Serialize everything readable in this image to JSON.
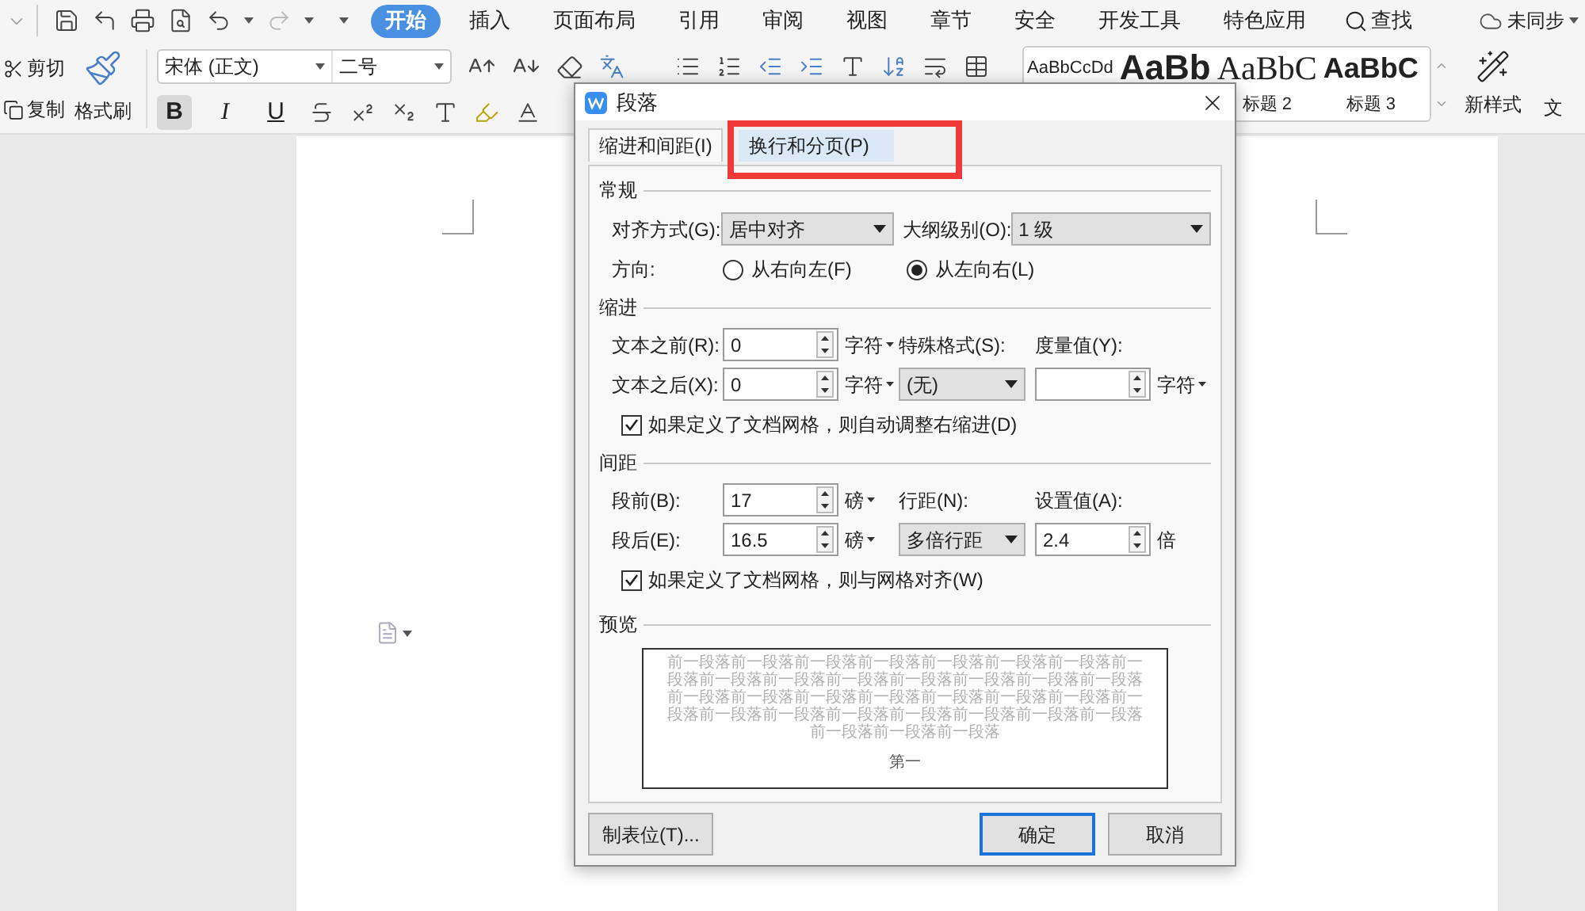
{
  "menu_tabs": [
    {
      "label": "开始",
      "selected": true
    },
    {
      "label": "插入",
      "selected": false
    },
    {
      "label": "页面布局",
      "selected": false
    },
    {
      "label": "引用",
      "selected": false
    },
    {
      "label": "审阅",
      "selected": false
    },
    {
      "label": "视图",
      "selected": false
    },
    {
      "label": "章节",
      "selected": false
    },
    {
      "label": "安全",
      "selected": false
    },
    {
      "label": "开发工具",
      "selected": false
    },
    {
      "label": "特色应用",
      "selected": false
    }
  ],
  "search": "查找",
  "sync_status": "未同步",
  "clipboard": {
    "cut": "剪切",
    "copy": "复制",
    "format_painter": "格式刷"
  },
  "font": {
    "name": "宋体 (正文)",
    "size": "二号"
  },
  "format_buttons": [
    {
      "label": "B",
      "selected": true
    },
    {
      "label": "I",
      "selected": false
    },
    {
      "label": "U",
      "selected": false
    }
  ],
  "styles": [
    {
      "kind": "normal",
      "sample": "AaBbCcDd"
    },
    {
      "kind": "heading1",
      "sample": "AaBb"
    },
    {
      "kind": "heading2",
      "sample": "AaBbC",
      "label": "标题 2"
    },
    {
      "kind": "heading3",
      "sample": "AaBbC",
      "label": "标题 3"
    }
  ],
  "new_style": "新样式",
  "doc_tool": "文",
  "dialog": {
    "title": "段落",
    "tabs": [
      {
        "label": "缩进和间距(I)",
        "selected": true,
        "highlighted": false
      },
      {
        "label": "换行和分页(P)",
        "selected": false,
        "highlighted": true
      }
    ],
    "general": {
      "title": "常规",
      "alignment": {
        "label": "对齐方式(G):",
        "value": "居中对齐"
      },
      "outline": {
        "label": "大纲级别(O):",
        "value": "1 级"
      },
      "direction": {
        "label": "方向:",
        "options": [
          {
            "label": "从右向左(F)",
            "selected": false
          },
          {
            "label": "从左向右(L)",
            "selected": true
          }
        ]
      }
    },
    "indent": {
      "title": "缩进",
      "before": {
        "label": "文本之前(R):",
        "value": "0",
        "unit": "字符",
        "unit_dropdown": true
      },
      "after": {
        "label": "文本之后(X):",
        "value": "0",
        "unit": "字符",
        "unit_dropdown": true
      },
      "special": {
        "label": "特殊格式(S):",
        "value": "(无)"
      },
      "measure": {
        "label": "度量值(Y):",
        "unit": "字符",
        "unit_dropdown": true
      },
      "grid_option": {
        "label": "如果定义了文档网格，则自动调整右缩进(D)",
        "checked": true
      }
    },
    "spacing": {
      "title": "间距",
      "before": {
        "label": "段前(B):",
        "value": "17",
        "unit": "磅",
        "unit_dropdown": true
      },
      "after": {
        "label": "段后(E):",
        "value": "16.5",
        "unit": "磅",
        "unit_dropdown": true
      },
      "line_spacing": {
        "label": "行距(N):",
        "value": "多倍行距"
      },
      "set_value": {
        "label": "设置值(A):",
        "value": "2.4",
        "unit": "倍",
        "unit_dropdown": false
      },
      "grid_option": {
        "label": "如果定义了文档网格，则与网格对齐(W)",
        "checked": true
      }
    },
    "preview": {
      "title": "预览",
      "preceding_text": "前一段落前一段落前一段落前一段落前一段落前一段落前一段落前一段落前一段落前一段落前一段落前一段落前一段落前一段落前一段落前一段落前一段落前一段落前一段落前一段落前一段落前一段落前一段落前一段落前一段落前一段落前一段落前一段落前一段落前一段落前一段落前一段落前一段落",
      "sample_text": "第一"
    },
    "buttons": {
      "tabs": "制表位(T)...",
      "ok": "确定",
      "cancel": "取消"
    }
  }
}
